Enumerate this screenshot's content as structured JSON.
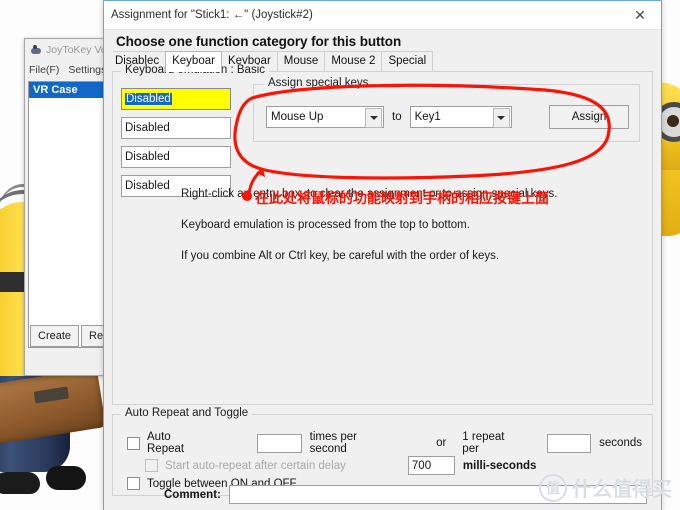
{
  "wallpaper": {
    "description": "minion-wallpaper"
  },
  "background_window": {
    "title": "JoyToKey Ve",
    "icon": "joystick-icon",
    "menu": [
      "File(F)",
      "Settings("
    ],
    "list_items": [
      "VR Case"
    ],
    "buttons": [
      "Create",
      "Rem"
    ]
  },
  "dialog": {
    "title": "Assignment for \"Stick1: ←\" (Joystick#2)",
    "close_icon": "✕",
    "heading": "Choose one function category for this button",
    "tabs": [
      {
        "label": "Disablec",
        "selected": false
      },
      {
        "label": "Keyboar",
        "selected": true
      },
      {
        "label": "Keyboar",
        "selected": false
      },
      {
        "label": "Mouse",
        "selected": false
      },
      {
        "label": "Mouse 2",
        "selected": false
      },
      {
        "label": "Special",
        "selected": false
      }
    ],
    "emulation_group": {
      "legend": "Keyboard emulation : Basic",
      "entries": [
        {
          "value": "Disabled",
          "highlighted": true
        },
        {
          "value": "Disabled",
          "highlighted": false
        },
        {
          "value": "Disabled",
          "highlighted": false
        },
        {
          "value": "Disabled",
          "highlighted": false
        }
      ],
      "special_group": {
        "legend": "Assign special keys...",
        "source_value": "Mouse Up",
        "to_label": "to",
        "target_value": "Key1",
        "assign_label": "Assign",
        "dropdown_icon": "chevron-down-icon"
      },
      "notes": [
        "Right-click an entry box, to clear the assignment or to assign special keys.",
        "Keyboard emulation is processed from the top to bottom.",
        "If you combine Alt or Ctrl key, be careful with the order of keys."
      ]
    },
    "repeat_group": {
      "legend": "Auto Repeat and Toggle",
      "auto_repeat_label": "Auto Repeat",
      "auto_repeat_checked": false,
      "times_value": "",
      "times_label": "times per second",
      "or_label": "or",
      "one_repeat_label": "1 repeat per",
      "seconds_value": "",
      "seconds_label": "seconds",
      "delay_label": "Start auto-repeat after certain delay",
      "delay_checked": false,
      "delay_value": "700",
      "delay_unit": "milli-seconds",
      "toggle_label": "Toggle between ON and OFF",
      "toggle_checked": false
    },
    "comment_label": "Comment:",
    "comment_value": ""
  },
  "annotation": {
    "text": "在此处将鼠标的功能映射到手柄的相应按键上面",
    "color": "#fb1405",
    "shapes": "ellipse-circle-and-arrow"
  },
  "watermark": {
    "badge": "值",
    "text": "什么值得买"
  },
  "colors": {
    "accent_blue": "#1268c8",
    "highlight_yellow": "#ffff00",
    "annotation_red": "#fb1405",
    "dialog_bg": "#f0f0f0"
  }
}
